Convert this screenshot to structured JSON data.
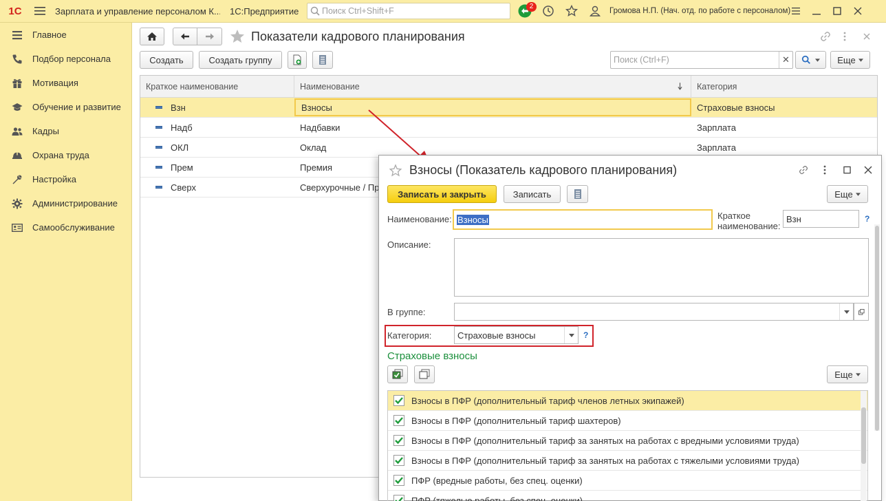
{
  "topbar": {
    "logo": "1С",
    "title": "Зарплата и управление персоналом К...",
    "app": "1С:Предприятие",
    "search_placeholder": "Поиск Ctrl+Shift+F",
    "notifications_count": "2",
    "user": "Громова Н.П. (Нач. отд. по работе с персоналом)"
  },
  "sidebar": {
    "items": [
      {
        "label": "Главное",
        "icon": "menu-lines-icon"
      },
      {
        "label": "Подбор персонала",
        "icon": "phone-icon"
      },
      {
        "label": "Мотивация",
        "icon": "gift-icon"
      },
      {
        "label": "Обучение и развитие",
        "icon": "graduation-cap-icon"
      },
      {
        "label": "Кадры",
        "icon": "users-icon"
      },
      {
        "label": "Охрана труда",
        "icon": "helmet-icon"
      },
      {
        "label": "Настройка",
        "icon": "wrench-icon"
      },
      {
        "label": "Администрирование",
        "icon": "gear-icon"
      },
      {
        "label": "Самообслуживание",
        "icon": "id-card-icon"
      }
    ]
  },
  "page": {
    "title": "Показатели кадрового планирования",
    "create_label": "Создать",
    "create_group_label": "Создать группу",
    "search_placeholder": "Поиск (Ctrl+F)",
    "more_label": "Еще"
  },
  "list": {
    "columns": [
      "Краткое наименование",
      "Наименование",
      "Категория"
    ],
    "rows": [
      {
        "short": "Взн",
        "name": "Взносы",
        "category": "Страховые взносы"
      },
      {
        "short": "Надб",
        "name": "Надбавки",
        "category": "Зарплата"
      },
      {
        "short": "ОКЛ",
        "name": "Оклад",
        "category": "Зарплата"
      },
      {
        "short": "Прем",
        "name": "Премия",
        "category": ""
      },
      {
        "short": "Сверх",
        "name": "Сверхурочные / Пр",
        "category": ""
      }
    ]
  },
  "form": {
    "title": "Взносы (Показатель кадрового планирования)",
    "save_close_label": "Записать и закрыть",
    "save_label": "Записать",
    "more_label": "Еще",
    "name_label": "Наименование:",
    "name_value": "Взносы",
    "short_label_1": "Краткое",
    "short_label_2": "наименование:",
    "short_value": "Взн",
    "description_label": "Описание:",
    "group_label": "В группе:",
    "category_label": "Категория:",
    "category_value": "Страховые взносы",
    "help": "?",
    "section_title": "Страховые взносы",
    "section_more_label": "Еще",
    "contributions": [
      {
        "label": "Взносы в ПФР (дополнительный тариф членов летных экипажей)",
        "checked": true
      },
      {
        "label": "Взносы в ПФР (дополнительный тариф шахтеров)",
        "checked": true
      },
      {
        "label": "Взносы в ПФР (дополнительный тариф за занятых на работах с вредными условиями труда)",
        "checked": true
      },
      {
        "label": "Взносы в ПФР (дополнительный тариф за занятых на работах с тяжелыми условиями труда)",
        "checked": true
      },
      {
        "label": "ПФР (вредные работы, без спец. оценки)",
        "checked": true
      },
      {
        "label": "ПФР (тяжелые работы, без спец. оценки)",
        "checked": true
      }
    ]
  },
  "colors": {
    "accent_yellow": "#fbeda5",
    "primary_button": "#f5ce0e",
    "highlight_red": "#d0232a",
    "section_green": "#1b8f3c"
  }
}
